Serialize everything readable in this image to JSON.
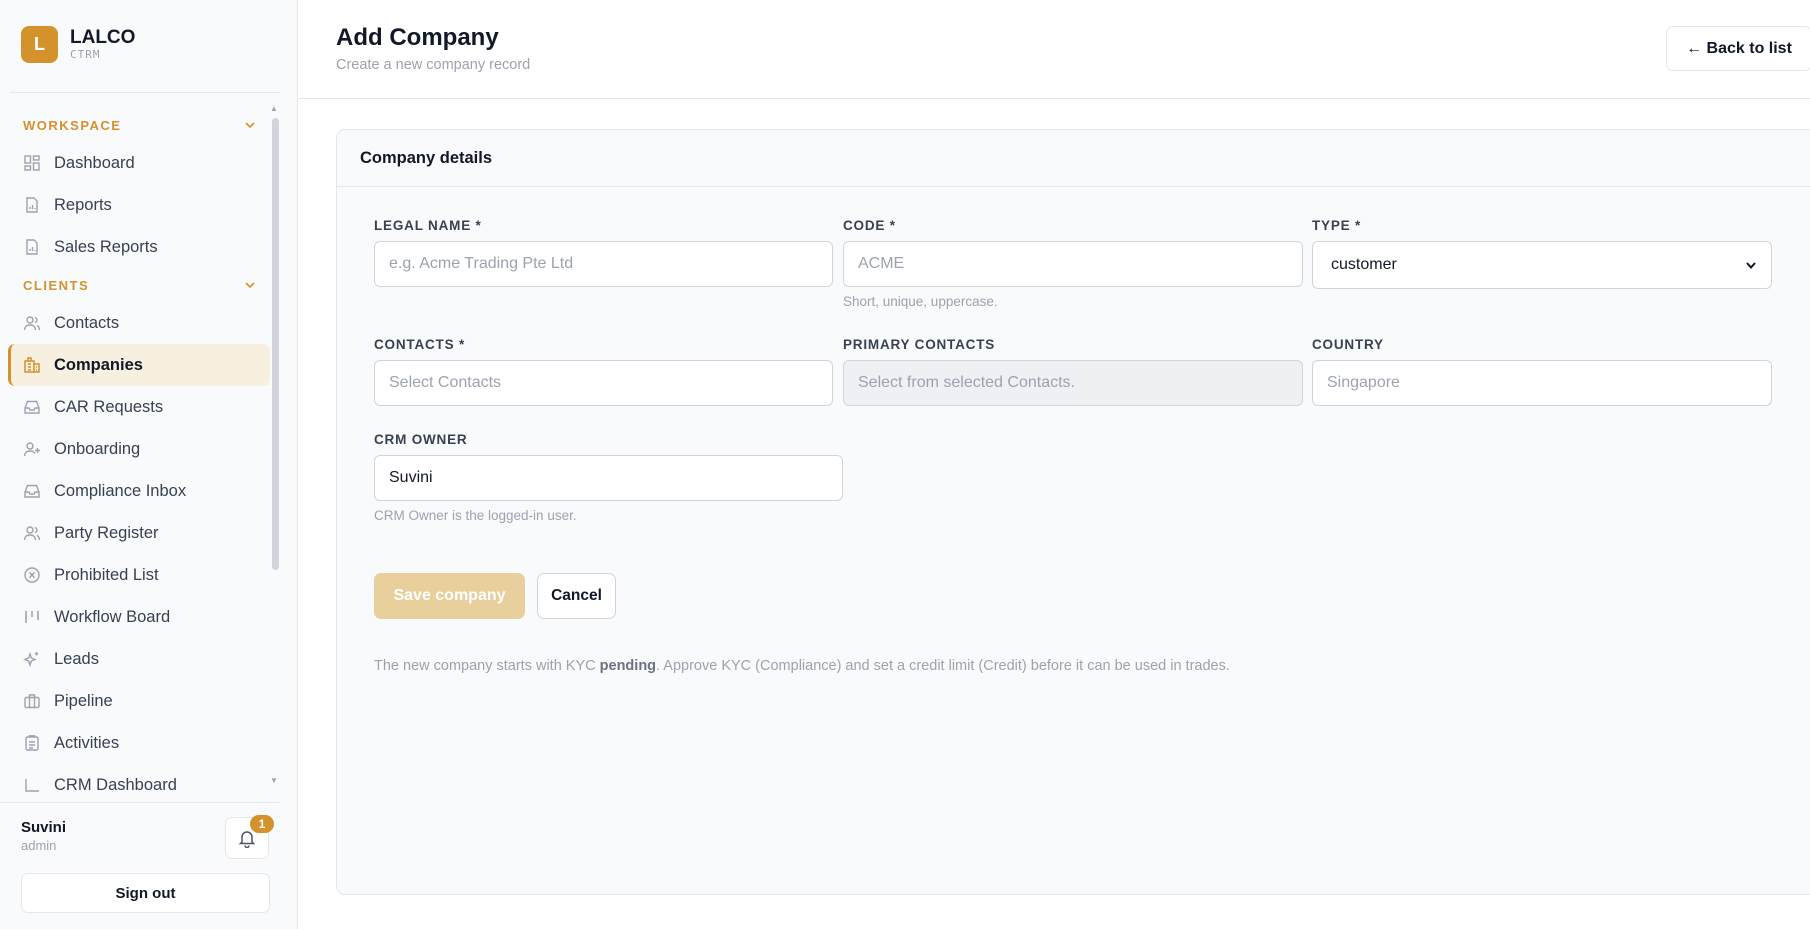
{
  "brand": {
    "logo_letter": "L",
    "name": "LALCO",
    "sub": "CTRM",
    "accent": "#d4922c"
  },
  "sidebar": {
    "sections": [
      {
        "label": "WORKSPACE",
        "items": [
          {
            "label": "Dashboard",
            "icon": "grid-icon"
          },
          {
            "label": "Reports",
            "icon": "file-chart-icon"
          },
          {
            "label": "Sales Reports",
            "icon": "file-chart-icon"
          }
        ]
      },
      {
        "label": "CLIENTS",
        "items": [
          {
            "label": "Contacts",
            "icon": "users-icon"
          },
          {
            "label": "Companies",
            "icon": "building-icon",
            "active": true
          },
          {
            "label": "CAR Requests",
            "icon": "inbox-icon"
          },
          {
            "label": "Onboarding",
            "icon": "user-plus-icon"
          },
          {
            "label": "Compliance Inbox",
            "icon": "inbox-icon"
          },
          {
            "label": "Party Register",
            "icon": "users-icon"
          },
          {
            "label": "Prohibited List",
            "icon": "x-circle-icon"
          },
          {
            "label": "Workflow Board",
            "icon": "kanban-icon"
          },
          {
            "label": "Leads",
            "icon": "sparkle-icon"
          },
          {
            "label": "Pipeline",
            "icon": "briefcase-icon"
          },
          {
            "label": "Activities",
            "icon": "clipboard-icon"
          },
          {
            "label": "CRM Dashboard",
            "icon": "chart-icon"
          }
        ]
      }
    ]
  },
  "user": {
    "name": "Suvini",
    "role": "admin",
    "notifications": "1",
    "sign_out_label": "Sign out"
  },
  "header": {
    "title": "Add Company",
    "subtitle": "Create a new company record",
    "back_label": "← Back to list"
  },
  "form": {
    "card_title": "Company details",
    "legal_name": {
      "label": "LEGAL NAME *",
      "placeholder": "e.g. Acme Trading Pte Ltd"
    },
    "code": {
      "label": "CODE *",
      "placeholder": "ACME",
      "hint": "Short, unique, uppercase."
    },
    "type": {
      "label": "TYPE *",
      "value": "customer"
    },
    "contacts": {
      "label": "CONTACTS *",
      "placeholder": "Select Contacts"
    },
    "primary_contacts": {
      "label": "PRIMARY CONTACTS",
      "placeholder": "Select from selected Contacts."
    },
    "country": {
      "label": "COUNTRY",
      "placeholder": "Singapore"
    },
    "crm_owner": {
      "label": "CRM OWNER",
      "value": "Suvini",
      "hint": "CRM Owner is the logged-in user."
    },
    "save_label": "Save company",
    "cancel_label": "Cancel",
    "note_prefix": "The new company starts with KYC ",
    "note_bold": "pending",
    "note_suffix": ". Approve KYC (Compliance) and set a credit limit (Credit) before it can be used in trades."
  }
}
